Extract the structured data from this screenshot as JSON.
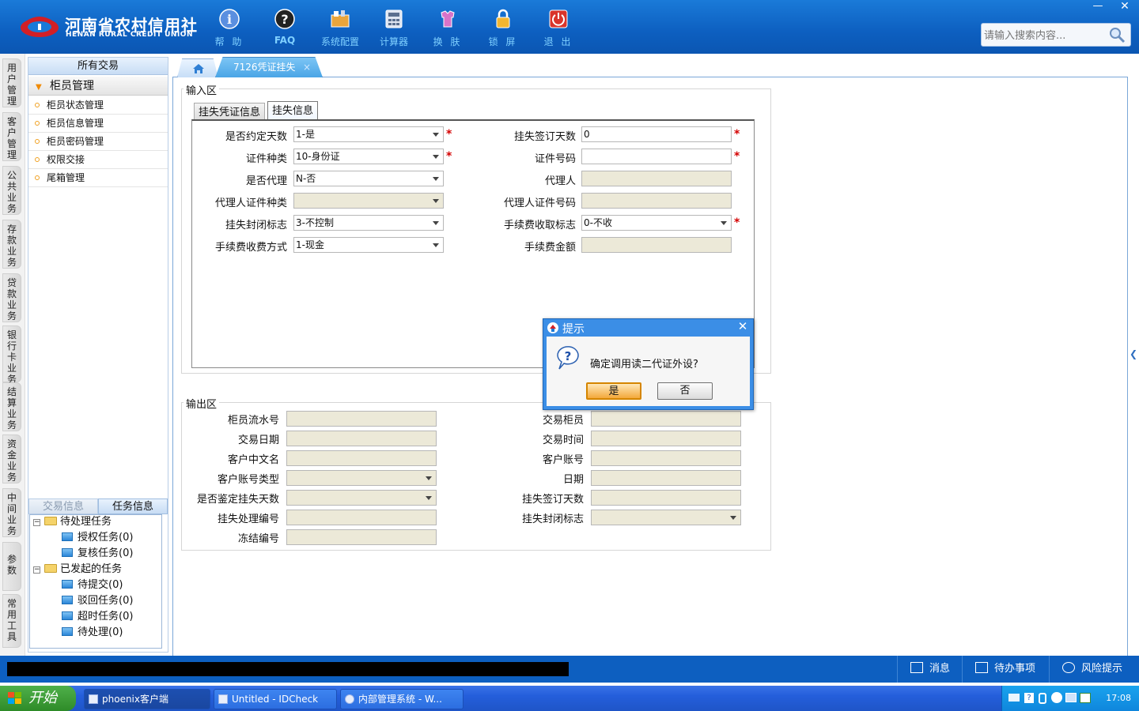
{
  "brand": {
    "cn": "河南省农村信用社",
    "en": "HENAN RURAL CREDIT UNION"
  },
  "toolbar": [
    {
      "label": "帮 助",
      "icon": "info-icon"
    },
    {
      "label": "FAQ",
      "icon": "help-icon"
    },
    {
      "label": "系统配置",
      "icon": "settings-icon"
    },
    {
      "label": "计算器",
      "icon": "calculator-icon"
    },
    {
      "label": "换 肤",
      "icon": "skin-icon"
    },
    {
      "label": "锁 屏",
      "icon": "lock-icon"
    },
    {
      "label": "退 出",
      "icon": "power-icon"
    }
  ],
  "window": {
    "minimize": "—",
    "close": "✕"
  },
  "search": {
    "placeholder": "请输入搜索内容..."
  },
  "left_nav": [
    "用户管理",
    "客户管理",
    "公共业务",
    "存款业务",
    "贷款业务",
    "银行卡业务",
    "结算业务",
    "资金业务",
    "中间业务",
    "参数",
    "常用工具"
  ],
  "side_panel": {
    "header": "所有交易",
    "group": "柜员管理",
    "items": [
      "柜员状态管理",
      "柜员信息管理",
      "柜员密码管理",
      "权限交接",
      "尾箱管理"
    ],
    "bottom_tabs": [
      "交易信息",
      "任务信息"
    ],
    "tree": {
      "pending": "待处理任务",
      "pending_children": [
        "授权任务(0)",
        "复核任务(0)"
      ],
      "initiated": "已发起的任务",
      "initiated_children": [
        "待提交(0)",
        "驳回任务(0)",
        "超时任务(0)",
        "待处理(0)"
      ]
    }
  },
  "tabs": {
    "active": "7126凭证挂失",
    "close": "×"
  },
  "input_area": {
    "legend": "输入区",
    "subtabs": [
      "挂失凭证信息",
      "挂失信息"
    ],
    "fields": {
      "agreed_days": {
        "label": "是否约定天数",
        "value": "1-是"
      },
      "signed_days": {
        "label": "挂失签订天数",
        "value": "0"
      },
      "id_type": {
        "label": "证件种类",
        "value": "10-身份证"
      },
      "id_no": {
        "label": "证件号码",
        "value": ""
      },
      "is_agent": {
        "label": "是否代理",
        "value": "N-否"
      },
      "agent": {
        "label": "代理人",
        "value": ""
      },
      "agent_id_type": {
        "label": "代理人证件种类",
        "value": ""
      },
      "agent_id_no": {
        "label": "代理人证件号码",
        "value": ""
      },
      "close_flag": {
        "label": "挂失封闭标志",
        "value": "3-不控制"
      },
      "fee_flag": {
        "label": "手续费收取标志",
        "value": "0-不收"
      },
      "fee_method": {
        "label": "手续费收费方式",
        "value": "1-现金"
      },
      "fee_amount": {
        "label": "手续费金额",
        "value": ""
      }
    },
    "required_mark": "*"
  },
  "output_area": {
    "legend": "输出区",
    "fields": {
      "teller_serial": "柜员流水号",
      "trade_teller": "交易柜员",
      "trade_date": "交易日期",
      "trade_time": "交易时间",
      "cust_name": "客户中文名",
      "cust_account": "客户账号",
      "acct_type": "客户账号类型",
      "date": "日期",
      "verify_days": "是否鉴定挂失天数",
      "signed_days": "挂失签订天数",
      "process_no": "挂失处理编号",
      "close_flag": "挂失封闭标志",
      "freeze_no": "冻结编号"
    }
  },
  "dialog": {
    "title": "提示",
    "message": "确定调用读二代证外设?",
    "yes": "是",
    "no": "否",
    "close": "✕"
  },
  "status_bar": {
    "messages": "消息",
    "todo": "待办事项",
    "risk": "风险提示"
  },
  "taskbar": {
    "start": "开始",
    "tasks": [
      "phoenix客户端",
      "Untitled - IDCheck",
      "内部管理系统 - W..."
    ],
    "clock": "17:08"
  },
  "colors": {
    "brand_blue": "#0d5fc0",
    "required": "#d40000",
    "tab_active": "#4aa5e6",
    "dialog_title": "#3b8ee6"
  }
}
